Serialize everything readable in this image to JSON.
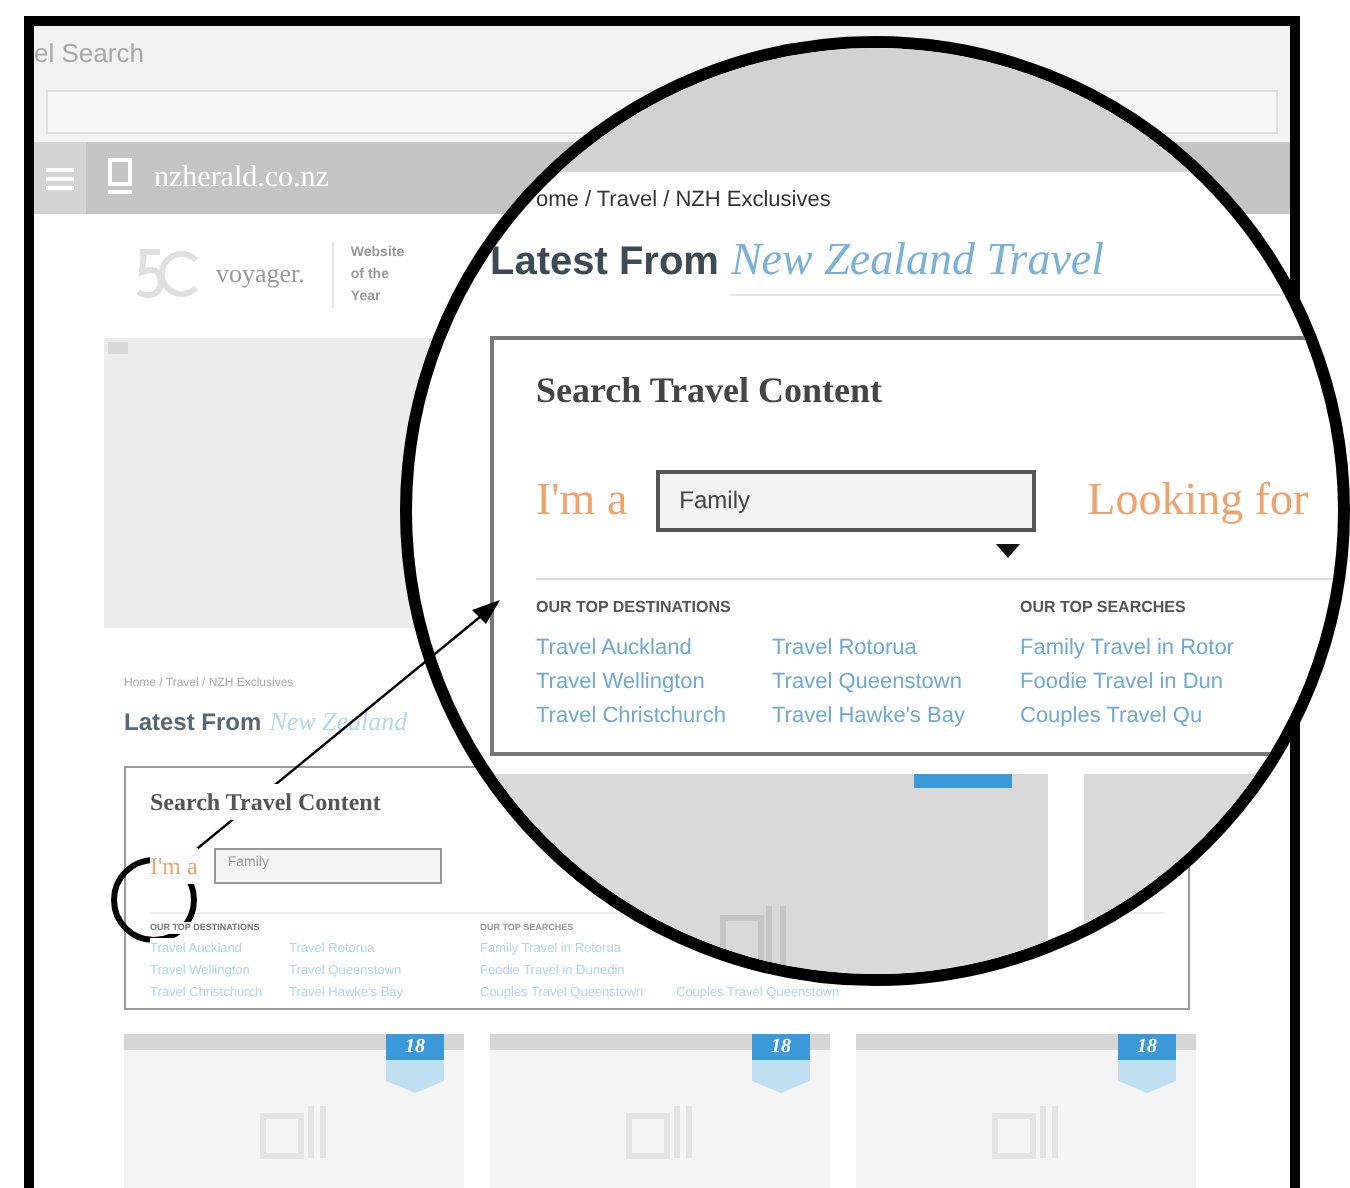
{
  "browser": {
    "title": "el Search"
  },
  "header": {
    "site": "nzherald.co.nz"
  },
  "award": {
    "brand": "voyager.",
    "text": "Website of the Year"
  },
  "page": {
    "breadcrumb": "Home / Travel / NZH Exclusives",
    "heading": "Latest From",
    "heading_accent": "New Zealand",
    "search": {
      "title": "Search Travel Content",
      "prefix": "I'm a",
      "field_value": "Family",
      "destinations_heading": "OUR TOP DESTINATIONS",
      "destinations": [
        "Travel Auckland",
        "Travel Wellington",
        "Travel Christchurch",
        "Travel Rotorua",
        "Travel Queenstown",
        "Travel Hawke's Bay"
      ],
      "searches_heading": "OUR TOP SEARCHES",
      "searches": [
        "Family Travel in Rotorua",
        "Foodie Travel in Dunedin",
        "Couples Travel Queenstown"
      ],
      "searches_more": [
        "Couples Travel Queenstown"
      ]
    }
  },
  "cards": [
    {
      "badge": "18"
    },
    {
      "badge": "18"
    },
    {
      "badge": "18"
    }
  ],
  "magnifier": {
    "breadcrumb": "ome / Travel / NZH Exclusives",
    "heading": "Latest From",
    "heading_accent": "New Zealand Travel",
    "search": {
      "title": "Search Travel Content",
      "prefix": "I'm a",
      "field_value": "Family",
      "suffix": "Looking for",
      "destinations_heading": "OUR TOP DESTINATIONS",
      "destinations": [
        "Travel Auckland",
        "Travel Wellington",
        "Travel Christchurch",
        "Travel Rotorua",
        "Travel Queenstown",
        "Travel Hawke's Bay"
      ],
      "searches_heading": "OUR TOP SEARCHES",
      "searches": [
        "Family Travel in Rotor",
        "Foodie Travel in Dun",
        "Couples Travel Qu"
      ]
    }
  }
}
